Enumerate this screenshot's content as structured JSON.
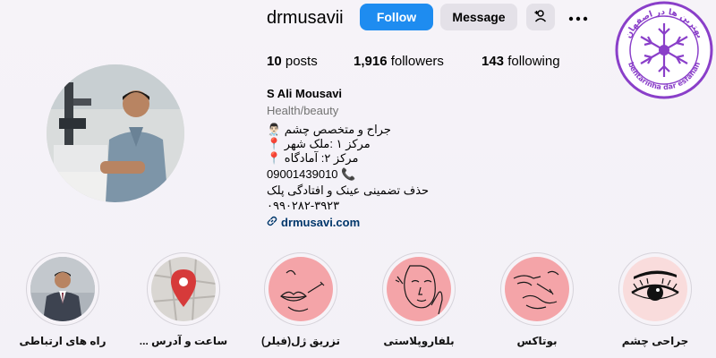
{
  "header": {
    "username": "drmusavii",
    "follow_label": "Follow",
    "message_label": "Message"
  },
  "stats": {
    "posts_count": "10",
    "posts_label": "posts",
    "followers_count": "1,916",
    "followers_label": "followers",
    "following_count": "143",
    "following_label": "following"
  },
  "bio": {
    "full_name": "S Ali Mousavi",
    "category": "Health/beauty",
    "lines": [
      "جراح و متخصص چشم 👨🏻‍⚕️",
      "مرکز ۱ :ملک شهر 📍",
      "مرکز ۲: آمادگاه 📍",
      "09001439010 📞",
      "حذف تضمینی عینک و افتادگی پلک",
      "۰۹۹۰۲۸۲-۳۹۲۳"
    ],
    "website": "drmusavi.com"
  },
  "badge": {
    "top_text": "بهترین ها در اصفهان",
    "bottom_text": "behtarinha dar esfahan"
  },
  "highlights": [
    {
      "label": "راه های ارتباطی",
      "icon": "doctor-photo"
    },
    {
      "label": "ساعت و آدرس ...",
      "icon": "map-pin-icon"
    },
    {
      "label": "تزریق ژل(فیلر)",
      "icon": "lips-injection-icon"
    },
    {
      "label": "بلفاروپلاستی",
      "icon": "face-line-art-icon"
    },
    {
      "label": "بوتاکس",
      "icon": "hands-injection-icon"
    },
    {
      "label": "جراحی چشم",
      "icon": "eye-icon"
    }
  ],
  "colors": {
    "follow_button": "#1e8cf0",
    "secondary_button": "#e4e1e8",
    "highlight_pink": "#f4a4a8",
    "link": "#00376b",
    "badge_purple": "#8a3fc9"
  }
}
